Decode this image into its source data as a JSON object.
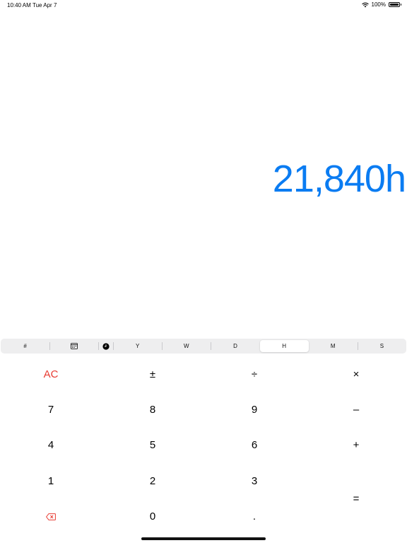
{
  "status_bar": {
    "time": "10:40 AM",
    "date": "Tue Apr 7",
    "battery": "100%"
  },
  "display": {
    "value": "21,840h",
    "color": "#0a7cf2"
  },
  "units": {
    "number": "#",
    "items": [
      {
        "label": "Y"
      },
      {
        "label": "W"
      },
      {
        "label": "D"
      },
      {
        "label": "H",
        "selected": true
      },
      {
        "label": "M"
      },
      {
        "label": "S"
      }
    ]
  },
  "keypad": {
    "clear": "AC",
    "plus_minus": "±",
    "divide": "÷",
    "multiply": "×",
    "seven": "7",
    "eight": "8",
    "nine": "9",
    "minus": "–",
    "four": "4",
    "five": "5",
    "six": "6",
    "plus": "+",
    "one": "1",
    "two": "2",
    "three": "3",
    "equals": "=",
    "zero": "0",
    "decimal": ".",
    "accent_red": "#e83b32"
  }
}
